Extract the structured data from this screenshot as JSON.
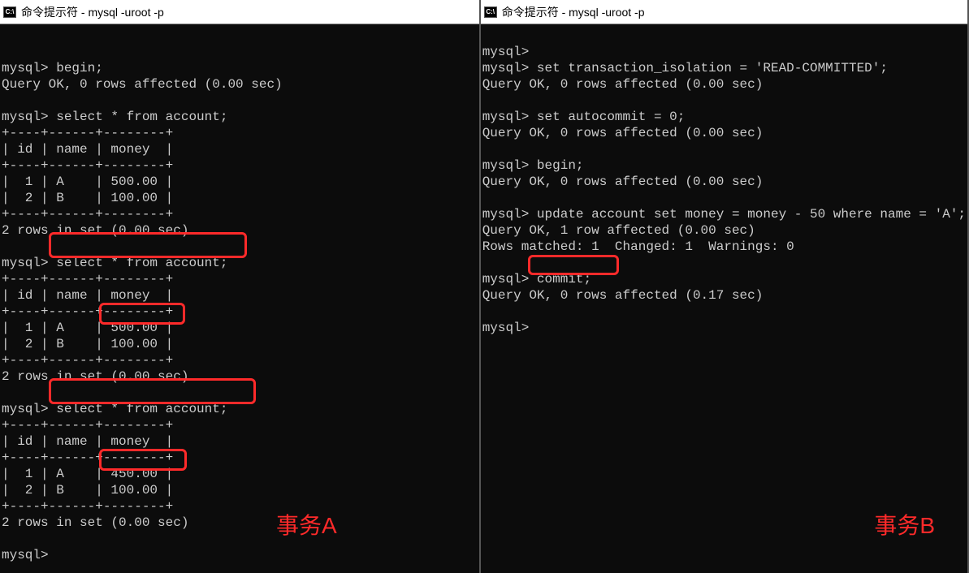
{
  "left": {
    "title": "命令提示符 - mysql  -uroot -p",
    "label": "事务A",
    "lines": {
      "l0": "",
      "l1": "mysql> begin;",
      "l2": "Query OK, 0 rows affected (0.00 sec)",
      "l3": "",
      "l4": "mysql> select * from account;",
      "l5": "+----+------+--------+",
      "l6": "| id | name | money  |",
      "l7": "+----+------+--------+",
      "l8": "|  1 | A    | 500.00 |",
      "l9": "|  2 | B    | 100.00 |",
      "l10": "+----+------+--------+",
      "l11": "2 rows in set (0.00 sec)",
      "l12": "",
      "l13": "mysql> select * from account;",
      "l14": "+----+------+--------+",
      "l15": "| id | name | money  |",
      "l16": "+----+------+--------+",
      "l17": "|  1 | A    | 500.00 |",
      "l18": "|  2 | B    | 100.00 |",
      "l19": "+----+------+--------+",
      "l20": "2 rows in set (0.00 sec)",
      "l21": "",
      "l22": "mysql> select * from account;",
      "l23": "+----+------+--------+",
      "l24": "| id | name | money  |",
      "l25": "+----+------+--------+",
      "l26": "|  1 | A    | 450.00 |",
      "l27": "|  2 | B    | 100.00 |",
      "l28": "+----+------+--------+",
      "l29": "2 rows in set (0.00 sec)",
      "l30": "",
      "l31": "mysql> "
    }
  },
  "right": {
    "title": "命令提示符 - mysql  -uroot -p",
    "label": "事务B",
    "lines": {
      "l0": "mysql>",
      "l1": "mysql> set transaction_isolation = 'READ-COMMITTED';",
      "l2": "Query OK, 0 rows affected (0.00 sec)",
      "l3": "",
      "l4": "mysql> set autocommit = 0;",
      "l5": "Query OK, 0 rows affected (0.00 sec)",
      "l6": "",
      "l7": "mysql> begin;",
      "l8": "Query OK, 0 rows affected (0.00 sec)",
      "l9": "",
      "l10": "mysql> update account set money = money - 50 where name = 'A';",
      "l11": "Query OK, 1 row affected (0.00 sec)",
      "l12": "Rows matched: 1  Changed: 1  Warnings: 0",
      "l13": "",
      "l14": "mysql> commit;",
      "l15": "Query OK, 0 rows affected (0.17 sec)",
      "l16": "",
      "l17": "mysql>"
    }
  }
}
